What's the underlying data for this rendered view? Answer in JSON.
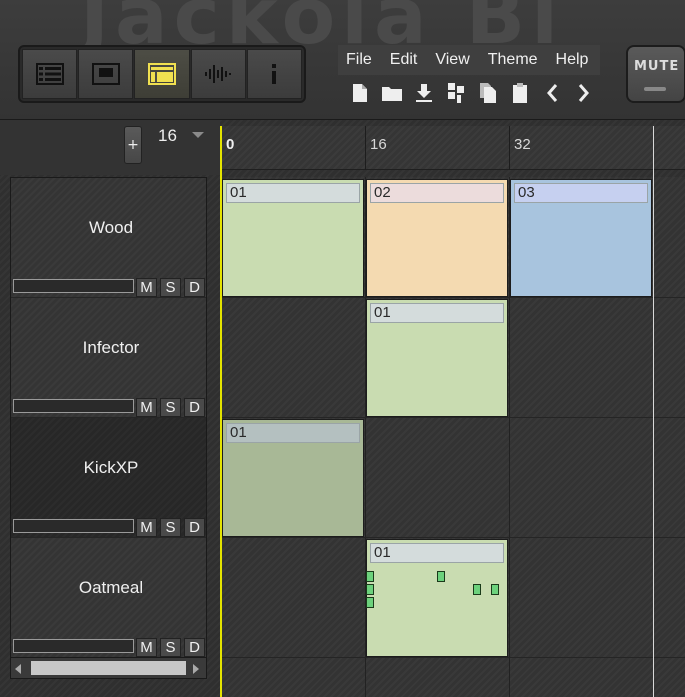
{
  "watermark": "Jackola Bi",
  "toolbar": {
    "view_buttons": [
      {
        "name": "song-list",
        "icon": "list-icon"
      },
      {
        "name": "piano-roll",
        "icon": "window-icon"
      },
      {
        "name": "song-editor",
        "icon": "tracks-icon",
        "active": true
      },
      {
        "name": "automation",
        "icon": "waveform-icon"
      },
      {
        "name": "info",
        "icon": "info-icon"
      }
    ],
    "menu": [
      "File",
      "Edit",
      "View",
      "Theme",
      "Help"
    ],
    "file_icons": [
      "new-file-icon",
      "open-folder-icon",
      "save-download-icon",
      "export-icon",
      "copy-icon",
      "paste-icon",
      "undo-arrow-icon",
      "redo-arrow-icon"
    ],
    "mute_label": "MUTE"
  },
  "left_panel": {
    "add_label": "+",
    "grid_size": "16"
  },
  "ruler": {
    "labels": [
      "0",
      "16",
      "32"
    ]
  },
  "tracks": [
    {
      "name": "Wood",
      "m": "M",
      "s": "S",
      "d": "D"
    },
    {
      "name": "Infector",
      "m": "M",
      "s": "S",
      "d": "D"
    },
    {
      "name": "KickXP",
      "m": "M",
      "s": "S",
      "d": "D",
      "selected": true
    },
    {
      "name": "Oatmeal",
      "m": "M",
      "s": "S",
      "d": "D"
    }
  ],
  "patterns": [
    {
      "track": 0,
      "col": 0,
      "label": "01",
      "color": "#c9dcb1",
      "label_bg": "#d4dcdc"
    },
    {
      "track": 0,
      "col": 1,
      "label": "02",
      "color": "#f4dab1",
      "label_bg": "#ecdcdc"
    },
    {
      "track": 0,
      "col": 2,
      "label": "03",
      "color": "#a8c4de",
      "label_bg": "#c6d0f0"
    },
    {
      "track": 1,
      "col": 1,
      "label": "01",
      "color": "#c9dcb1",
      "label_bg": "#d4dcdc"
    },
    {
      "track": 2,
      "col": 0,
      "label": "01",
      "color": "#a8b896",
      "label_bg": "#b4c0c0"
    },
    {
      "track": 3,
      "col": 1,
      "label": "01",
      "color": "#c9dcb1",
      "label_bg": "#d4dcdc"
    }
  ],
  "colors": {
    "playhead": "#e4e400",
    "active_view_icon": "#f0e050",
    "note": "#6cd17c"
  }
}
